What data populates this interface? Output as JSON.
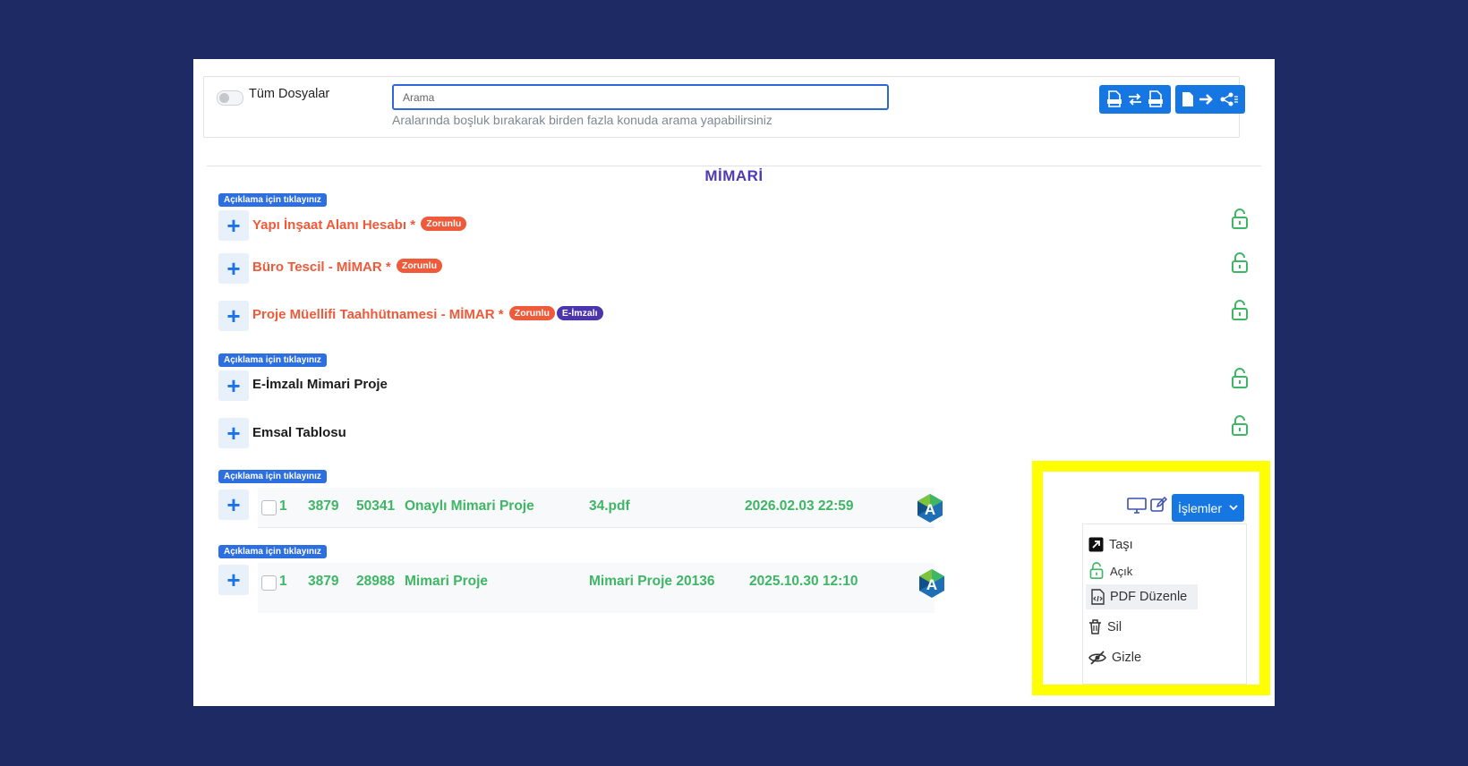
{
  "filter": {
    "toggle_label": "Tüm Dosyalar",
    "search_placeholder": "Arama",
    "search_hint": "Aralarında boşluk bırakarak birden fazla konuda arama yapabilirsiniz"
  },
  "section_title": "MİMARİ",
  "doc_items": [
    {
      "badge": "Açıklama için tıklayınız",
      "title": "Yapı İnşaat Alanı Hesabı",
      "required_mark": "*",
      "tags": [
        "Zorunlu"
      ]
    },
    {
      "title": "Büro Tescil - MİMAR",
      "required_mark": "*",
      "tags": [
        "Zorunlu"
      ]
    },
    {
      "title": "Proje Müellifi Taahhütnamesi - MİMAR",
      "required_mark": "*",
      "tags": [
        "Zorunlu",
        "E-İmzalı"
      ]
    },
    {
      "badge": "Açıklama için tıklayınız",
      "title": "E-İmzalı Mimari Proje"
    },
    {
      "title": "Emsal Tablosu"
    }
  ],
  "file_rows": [
    {
      "badge": "Açıklama için tıklayınız",
      "version": "1",
      "project_no": "3879",
      "file_no": "50341",
      "name": "Onaylı Mimari Proje",
      "file": "34.pdf",
      "date": "2026.02.03 22:59",
      "avatar_letter": "A"
    },
    {
      "badge": "Açıklama için tıklayınız",
      "version": "1",
      "project_no": "3879",
      "file_no": "28988",
      "name": "Mimari Proje",
      "file": "Mimari Proje  20136",
      "date": "2025.10.30 12:10",
      "avatar_letter": "A"
    }
  ],
  "actions": {
    "button_label": "İşlemler",
    "menu": [
      {
        "label": "Taşı",
        "icon": "move-icon"
      },
      {
        "label": "Açık",
        "icon": "unlock-icon"
      },
      {
        "label": "PDF Düzenle",
        "icon": "pdf-edit-icon"
      },
      {
        "label": "Sil",
        "icon": "trash-icon"
      },
      {
        "label": "Gizle",
        "icon": "eye-slash-icon"
      }
    ]
  },
  "colors": {
    "page_bg": "#1e2a64",
    "accent": "#1677e3",
    "required": "#ef5a3b",
    "file_text": "#3eb665",
    "section": "#4f3ab3",
    "highlight": "#ffff00"
  }
}
